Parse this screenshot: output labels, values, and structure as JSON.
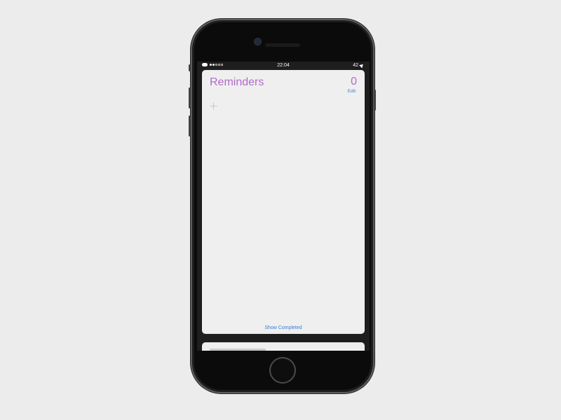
{
  "status_bar": {
    "time": "22:04",
    "right_text": "42"
  },
  "reminders": {
    "title": "Reminders",
    "count": "0",
    "edit_label": "Edit",
    "show_completed_label": "Show Completed"
  },
  "colors": {
    "accent_purple": "#b26ac9",
    "link_blue": "#3a7bd5",
    "background": "#ececec",
    "card": "#efefef"
  },
  "icons": {
    "add": "plus-icon",
    "location": "location-arrow-icon",
    "message": "chat-bubble-icon"
  }
}
